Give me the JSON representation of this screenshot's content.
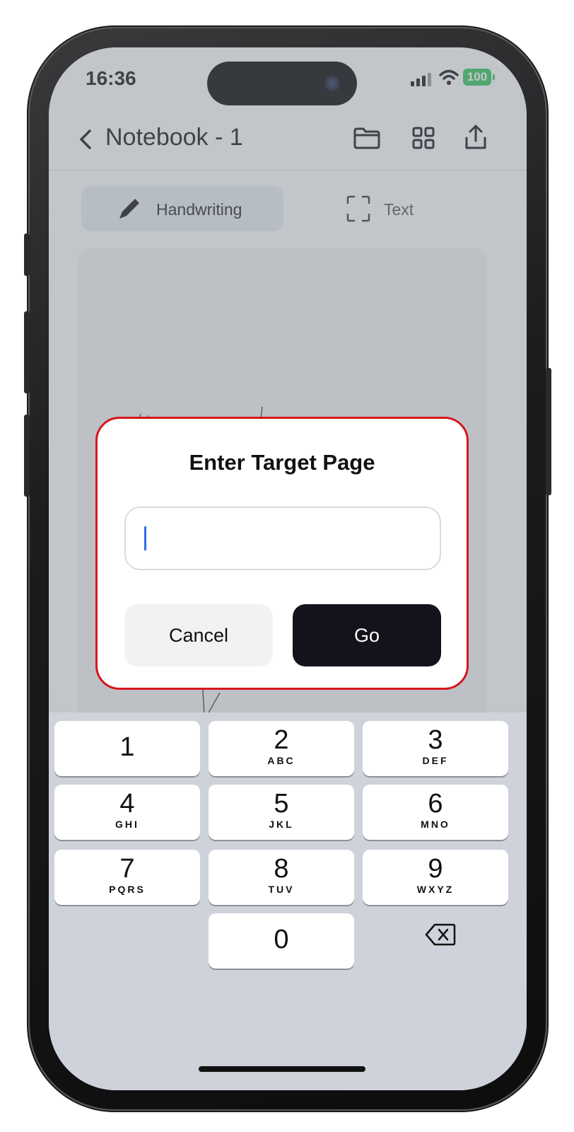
{
  "status_bar": {
    "time": "16:36",
    "battery_level": "100",
    "battery_color": "#34c759"
  },
  "nav": {
    "title": "Notebook - 1",
    "icons": [
      "chevron-left-icon",
      "folder-icon",
      "grid-icon",
      "share-icon"
    ]
  },
  "mode_tabs": {
    "handwriting_label": "Handwriting",
    "text_label": "Text",
    "active": "handwriting"
  },
  "dialog": {
    "title": "Enter Target Page",
    "input_value": "",
    "cancel_label": "Cancel",
    "go_label": "Go",
    "highlight_color": "#d7161b"
  },
  "keypad": {
    "keys": [
      {
        "num": "1",
        "letters": ""
      },
      {
        "num": "2",
        "letters": "ABC"
      },
      {
        "num": "3",
        "letters": "DEF"
      },
      {
        "num": "4",
        "letters": "GHI"
      },
      {
        "num": "5",
        "letters": "JKL"
      },
      {
        "num": "6",
        "letters": "MNO"
      },
      {
        "num": "7",
        "letters": "PQRS"
      },
      {
        "num": "8",
        "letters": "TUV"
      },
      {
        "num": "9",
        "letters": "WXYZ"
      },
      {
        "num": "0",
        "letters": ""
      }
    ]
  }
}
